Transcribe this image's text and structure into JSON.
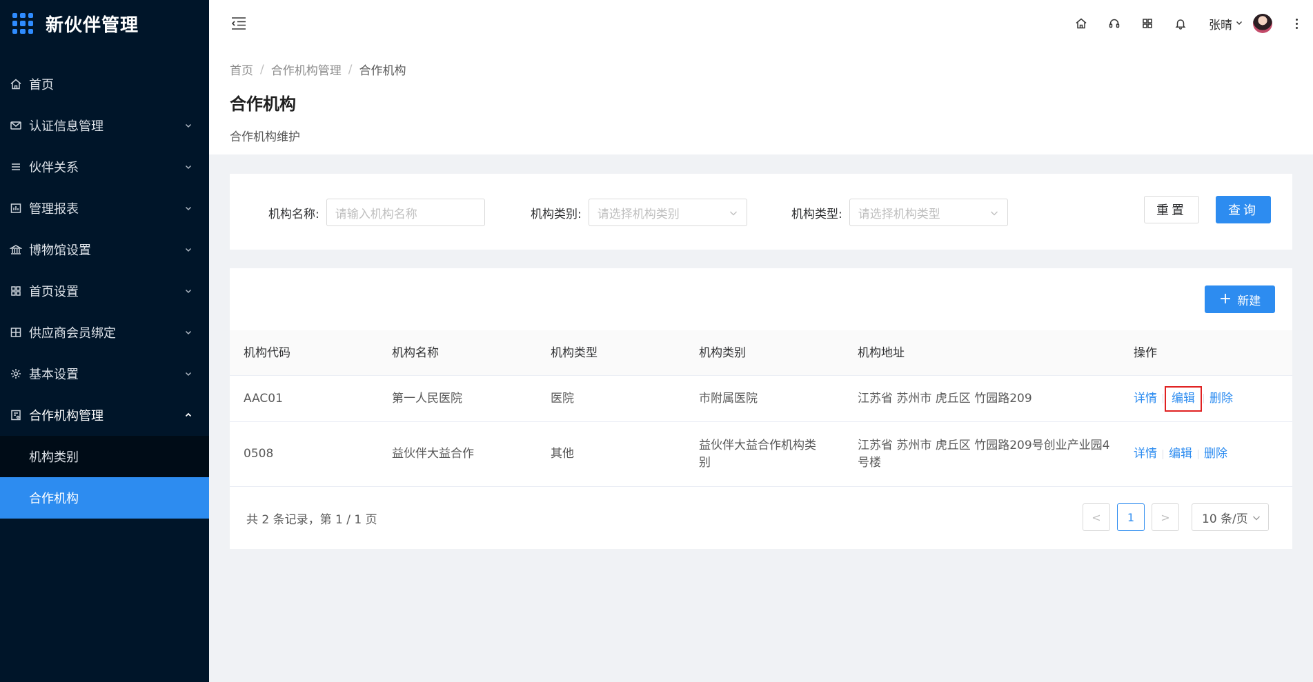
{
  "app": {
    "title": "新伙伴管理"
  },
  "sidebar": {
    "items": [
      {
        "label": "首页",
        "icon": "home-icon"
      },
      {
        "label": "认证信息管理",
        "icon": "mail-icon"
      },
      {
        "label": "伙伴关系",
        "icon": "list-icon"
      },
      {
        "label": "管理报表",
        "icon": "report-icon"
      },
      {
        "label": "博物馆设置",
        "icon": "museum-icon"
      },
      {
        "label": "首页设置",
        "icon": "layout-icon"
      },
      {
        "label": "供应商会员绑定",
        "icon": "bind-icon"
      },
      {
        "label": "基本设置",
        "icon": "gear-icon"
      },
      {
        "label": "合作机构管理",
        "icon": "org-icon"
      }
    ],
    "submenu": [
      {
        "label": "机构类别"
      },
      {
        "label": "合作机构"
      }
    ]
  },
  "header": {
    "user_name": "张晴",
    "icons": [
      "home-icon",
      "headset-icon",
      "apps-icon",
      "bell-icon"
    ]
  },
  "breadcrumb": {
    "home": "首页",
    "parent": "合作机构管理",
    "current": "合作机构",
    "sep": "/"
  },
  "page": {
    "title": "合作机构",
    "description": "合作机构维护"
  },
  "search": {
    "name_label": "机构名称:",
    "name_placeholder": "请输入机构名称",
    "category_label": "机构类别:",
    "category_placeholder": "请选择机构类别",
    "type_label": "机构类型:",
    "type_placeholder": "请选择机构类型",
    "reset_label": "重置",
    "query_label": "查询"
  },
  "toolbar": {
    "new_label": "新建"
  },
  "table": {
    "columns": [
      "机构代码",
      "机构名称",
      "机构类型",
      "机构类别",
      "机构地址",
      "操作"
    ],
    "rows": [
      {
        "code": "AAC01",
        "name": "第一人民医院",
        "type": "医院",
        "category": "市附属医院",
        "address": "江苏省 苏州市 虎丘区 竹园路209"
      },
      {
        "code": "0508",
        "name": "益伙伴大益合作",
        "type": "其他",
        "category": "益伙伴大益合作机构类别",
        "address": "江苏省 苏州市 虎丘区 竹园路209号创业产业园4号楼"
      }
    ],
    "actions": {
      "detail": "详情",
      "edit": "编辑",
      "delete": "删除"
    }
  },
  "pagination": {
    "summary": "共 2 条记录，第 1 / 1 页",
    "current_page": "1",
    "page_size": "10 条/页",
    "prev": "<",
    "next": ">"
  },
  "colors": {
    "primary": "#2d8cf0",
    "sidebar_bg": "#001529",
    "highlight": "#e02020"
  }
}
